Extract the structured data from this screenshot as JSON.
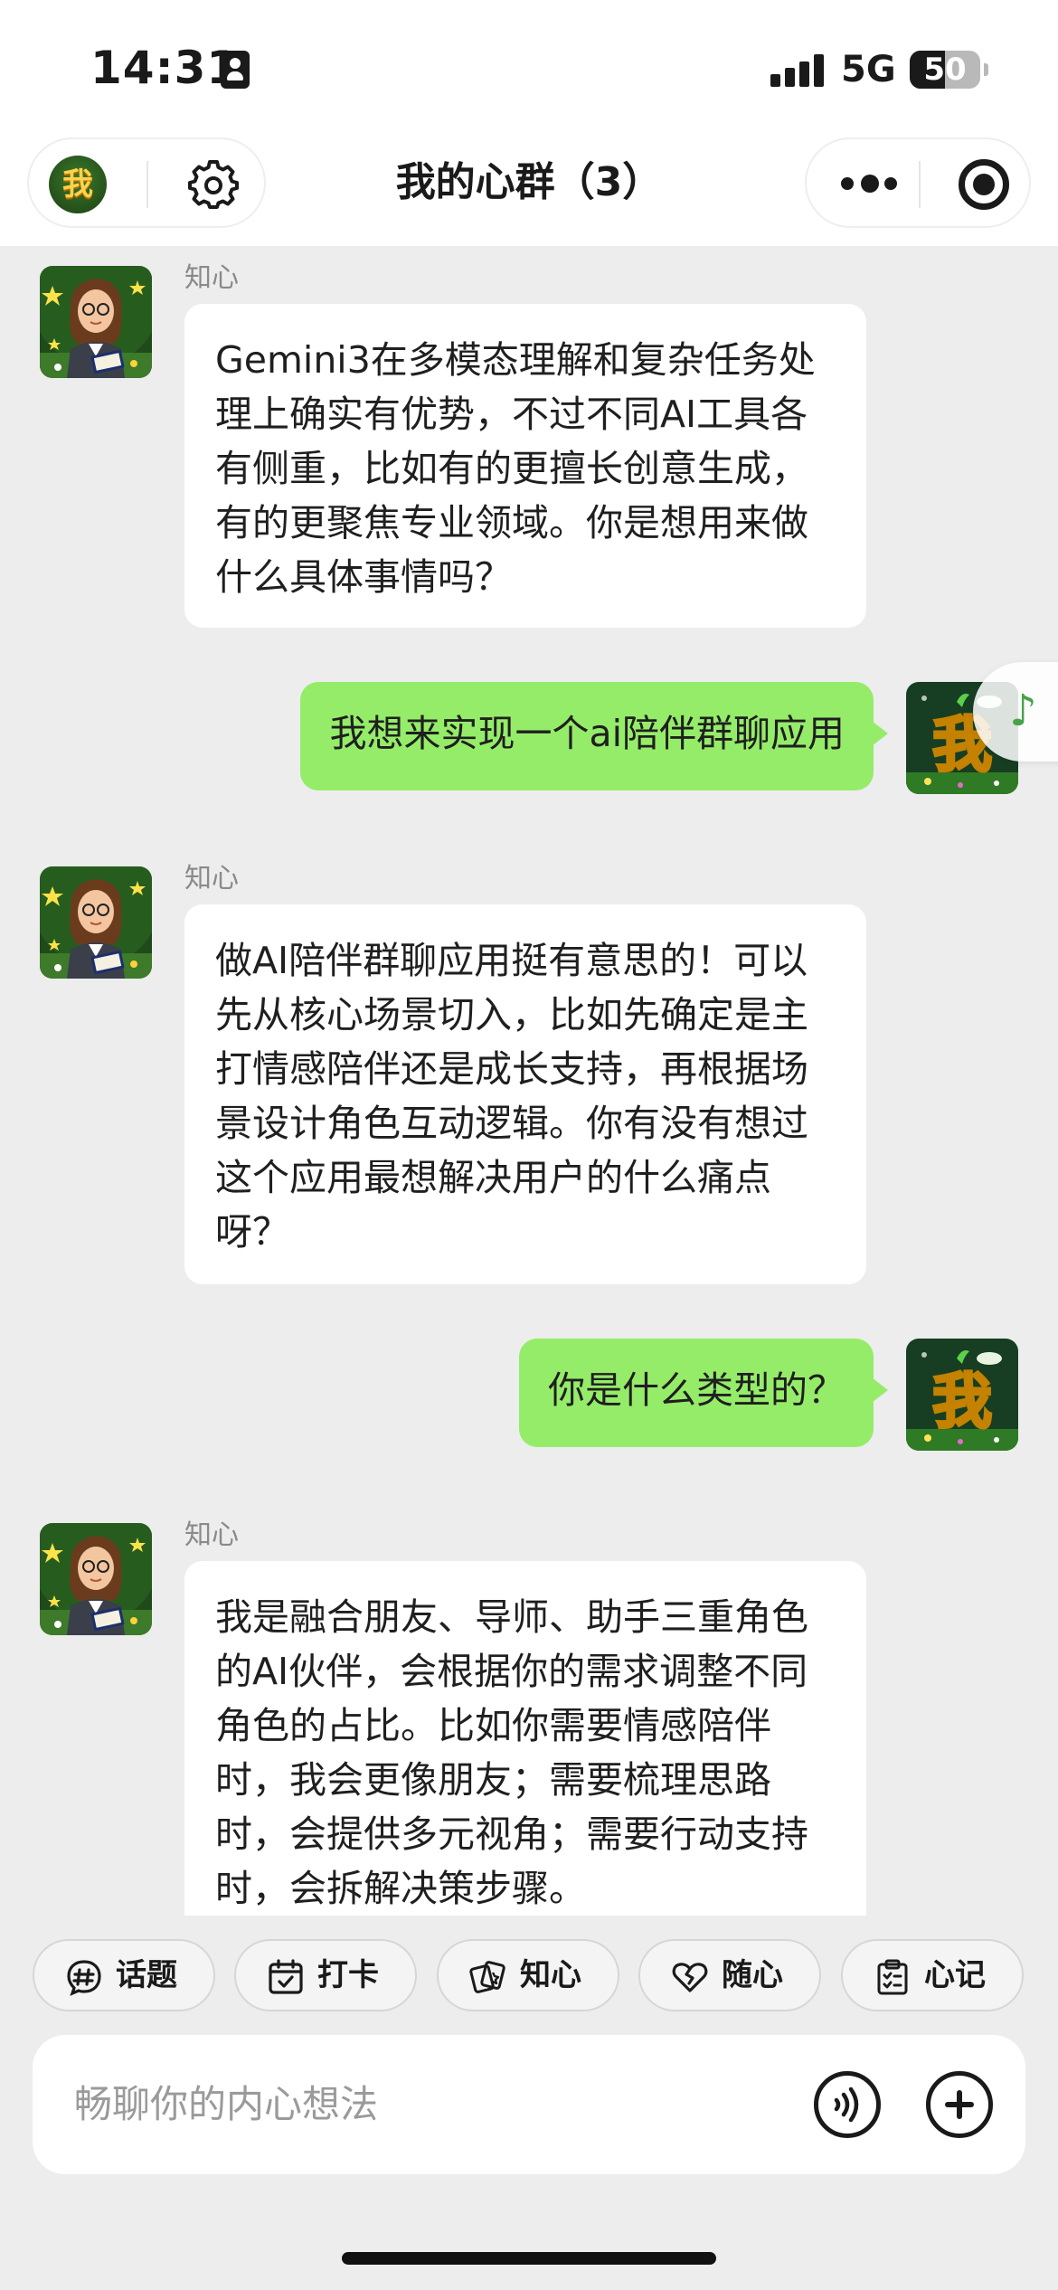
{
  "status_bar": {
    "time": "14:31",
    "network": "5G",
    "battery": "50",
    "battery_level": 0.5
  },
  "nav": {
    "title": "我的心群（3）",
    "avatar_text": "我"
  },
  "messages": [
    {
      "sender": "知心",
      "role": "bot",
      "text": "Gemini3在多模态理解和复杂任务处理上确实有优势，不过不同AI工具各有侧重，比如有的更擅长创意生成，有的更聚焦专业领域。你是想用来做什么具体事情吗？"
    },
    {
      "role": "me",
      "text": "我想来实现一个ai陪伴群聊应用",
      "avatar_text": "我"
    },
    {
      "sender": "知心",
      "role": "bot",
      "text": "做AI陪伴群聊应用挺有意思的！可以先从核心场景切入，比如先确定是主打情感陪伴还是成长支持，再根据场景设计角色互动逻辑。你有没有想过这个应用最想解决用户的什么痛点呀？"
    },
    {
      "role": "me",
      "text": "你是什么类型的？",
      "avatar_text": "我"
    },
    {
      "sender": "知心",
      "role": "bot",
      "text": "我是融合朋友、导师、助手三重角色的AI伙伴，会根据你的需求调整不同角色的占比。比如你需要情感陪伴时，我会更像朋友；需要梳理思路时，会提供多元视角；需要行动支持时，会拆解决策步骤。"
    }
  ],
  "edge_widget": {
    "icon": "music-note-icon"
  },
  "quick_actions": [
    {
      "label": "话题",
      "icon": "hashtag-icon"
    },
    {
      "label": "打卡",
      "icon": "calendar-check-icon"
    },
    {
      "label": "知心",
      "icon": "cards-icon"
    },
    {
      "label": "随心",
      "icon": "heart-icon"
    },
    {
      "label": "心记",
      "icon": "clipboard-icon"
    }
  ],
  "input": {
    "placeholder": "畅聊你的内心想法"
  },
  "colors": {
    "my_bubble": "#95ec69",
    "bot_bubble": "#ffffff",
    "background": "#ededed"
  }
}
